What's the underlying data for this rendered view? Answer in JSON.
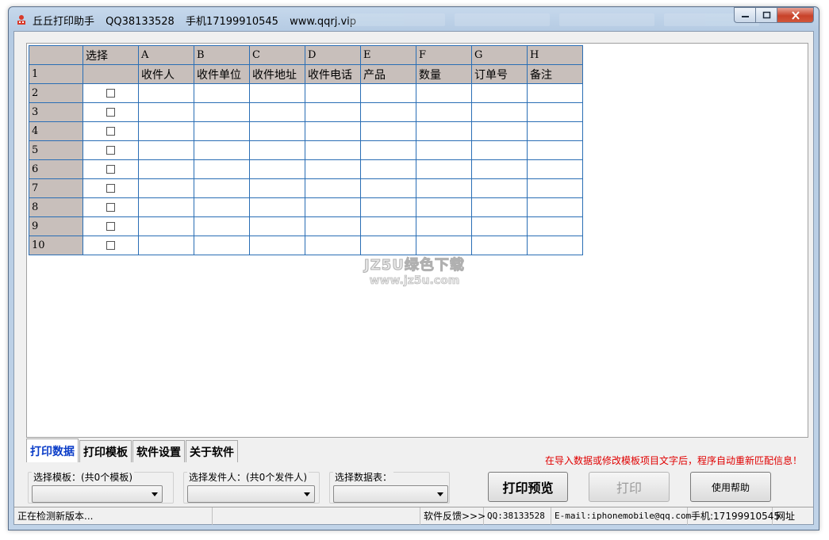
{
  "window": {
    "app_name": "丘丘打印助手",
    "qq": "QQ38133528",
    "phone": "手机17199910545",
    "website": "www.qqrj.vip"
  },
  "sheet": {
    "select_header": "选择",
    "column_letters": [
      "A",
      "B",
      "C",
      "D",
      "E",
      "F",
      "G",
      "H"
    ],
    "field_row_number": "1",
    "fields": [
      "收件人",
      "收件单位",
      "收件地址",
      "收件电话",
      "产品",
      "数量",
      "订单号",
      "备注"
    ],
    "row_numbers": [
      "2",
      "3",
      "4",
      "5",
      "6",
      "7",
      "8",
      "9",
      "10"
    ]
  },
  "watermark": {
    "line1": "JZ5U绿色下载",
    "line2": "www.jz5u.com"
  },
  "tabs": [
    "打印数据",
    "打印模板",
    "软件设置",
    "关于软件"
  ],
  "hint": "在导入数据或修改模板项目文字后，程序自动重新匹配信息！",
  "selectors": {
    "template_label": "选择模板：(共0个模板)",
    "sender_label": "选择发件人：(共0个发件人)",
    "table_label": "选择数据表："
  },
  "buttons": {
    "preview": "打印预览",
    "print": "打印",
    "help": "使用帮助"
  },
  "status": {
    "message": "正在检测新版本...",
    "feedback": "软件反馈>>>",
    "qq": "QQ:38133528",
    "email": "E-mail:iphonemobile@qq.com",
    "phone": "手机:17199910545",
    "url_label": "网址"
  }
}
